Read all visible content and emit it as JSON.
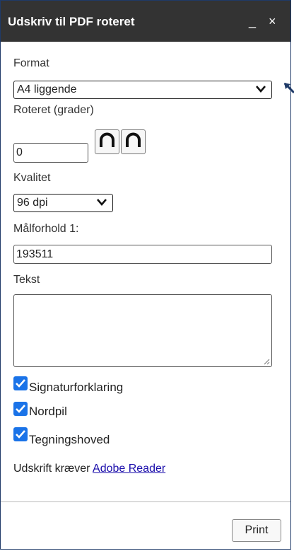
{
  "window": {
    "title": "Udskriv til PDF roteret",
    "minimize": "_",
    "close": "×"
  },
  "format": {
    "label": "Format",
    "value": "A4 liggende"
  },
  "rotation": {
    "label": "Roteret (grader)",
    "value": "0"
  },
  "quality": {
    "label": "Kvalitet",
    "value": "96 dpi"
  },
  "scale": {
    "label": "Målforhold 1:",
    "value": "193511"
  },
  "text": {
    "label": "Tekst",
    "value": ""
  },
  "options": [
    {
      "label": "Signaturforklaring",
      "checked": true
    },
    {
      "label": "Nordpil",
      "checked": true
    },
    {
      "label": "Tegningshoved",
      "checked": true
    }
  ],
  "footer": {
    "text": "Udskrift kræver ",
    "link": "Adobe Reader"
  },
  "print_button": "Print",
  "colors": {
    "titlebar": "#333333",
    "checkbox": "#1a73e8",
    "border": "#1f3a68",
    "link": "#1a0dab"
  }
}
